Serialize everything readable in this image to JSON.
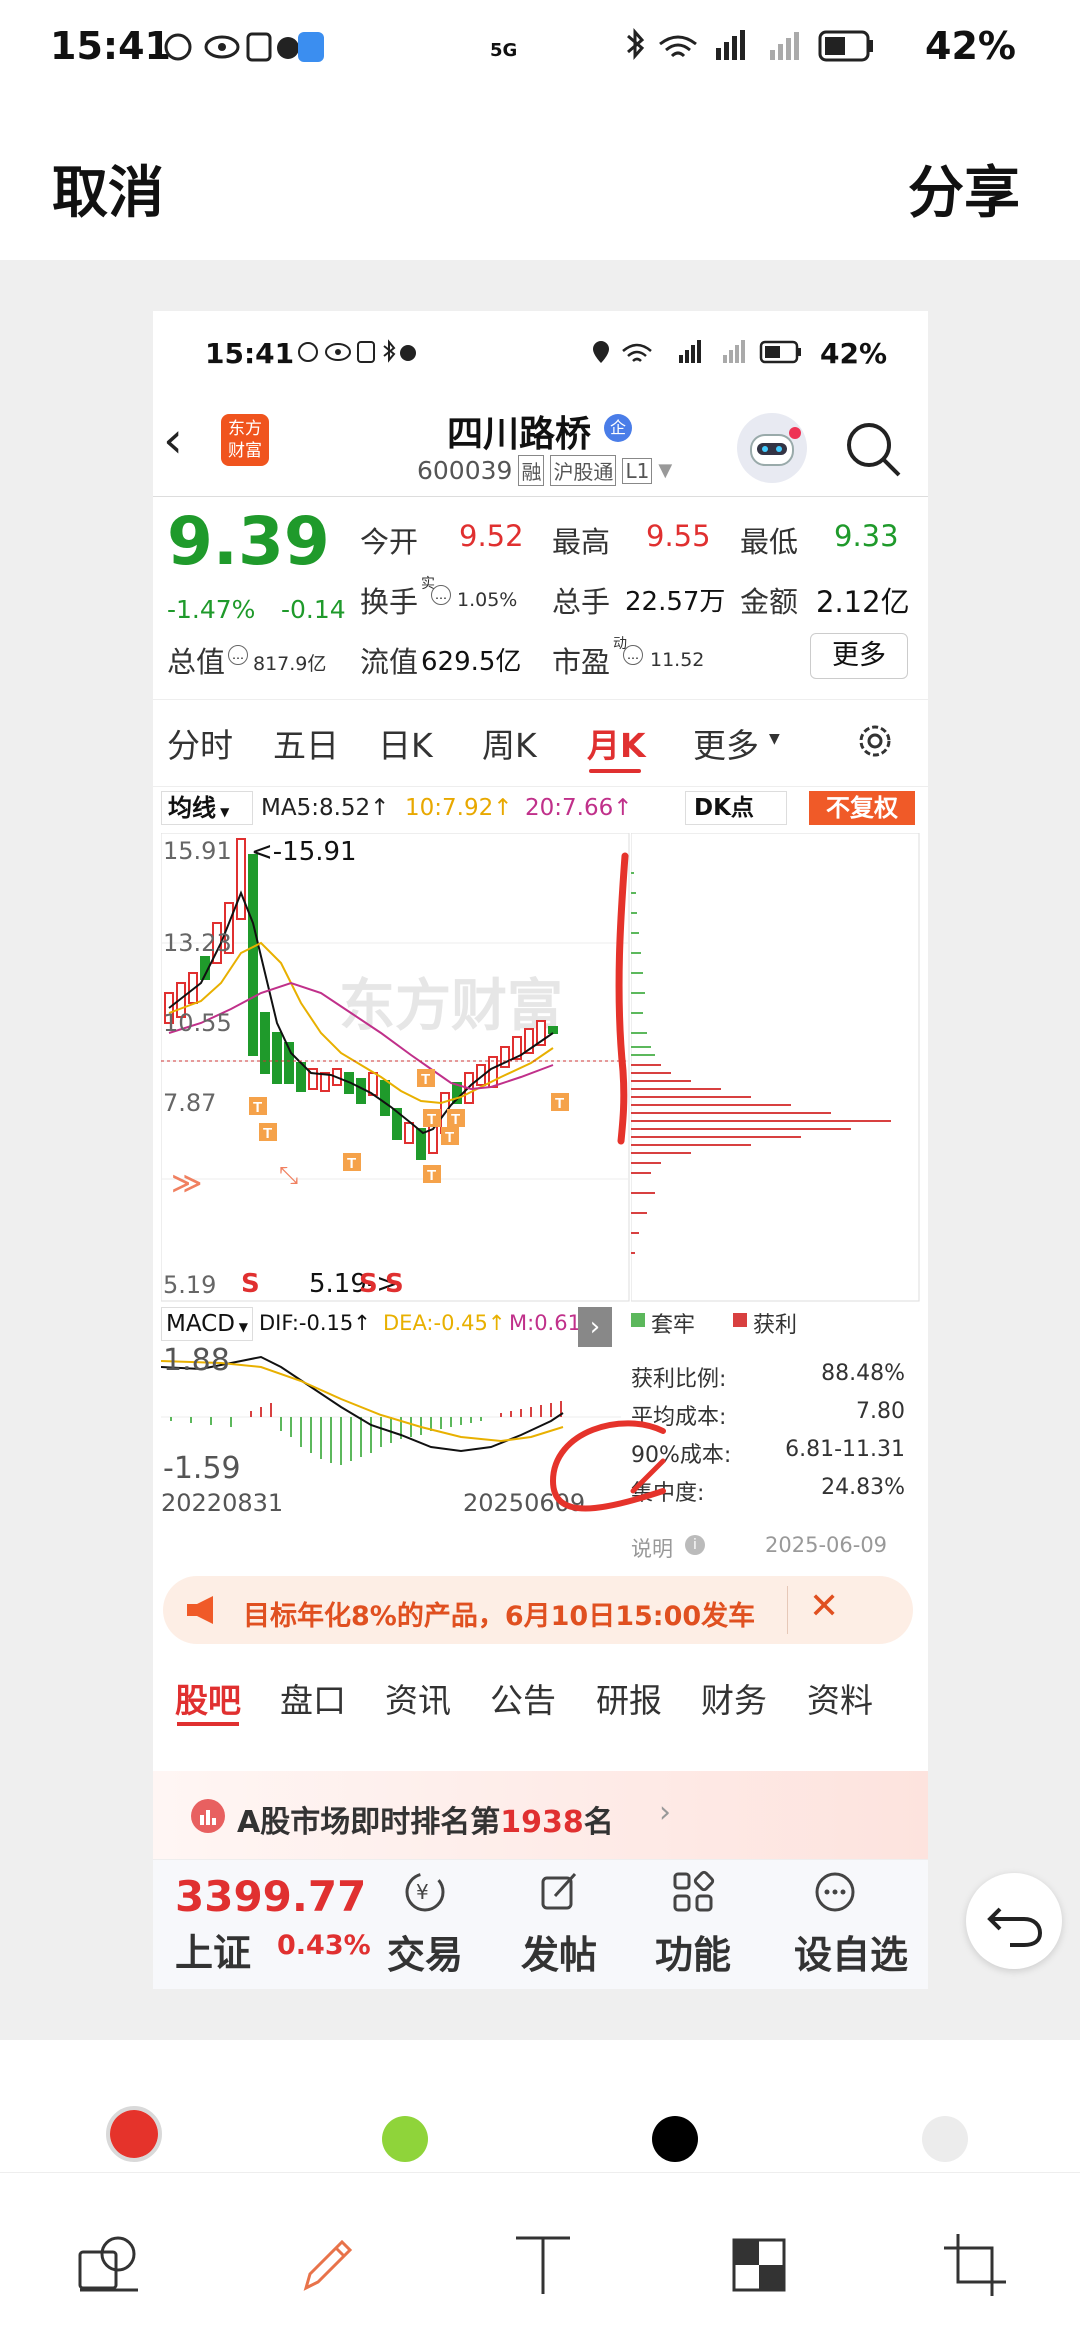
{
  "outer_status": {
    "time": "15:41",
    "network": "5G",
    "battery": "42%"
  },
  "topbar": {
    "cancel": "取消",
    "share": "分享"
  },
  "inner_status": {
    "time": "15:41",
    "network": "5G",
    "battery": "42%"
  },
  "header": {
    "logo_line1": "东方",
    "logo_line2": "财富",
    "stock_name": "四川路桥",
    "stock_badge": "企",
    "code": "600039",
    "tag_rong": "融",
    "tag_hgt": "沪股通",
    "tag_level": "L1"
  },
  "quote": {
    "price": "9.39",
    "change_pct": "-1.47%",
    "change_amt": "-0.14",
    "open_label": "今开",
    "open": "9.52",
    "high_label": "最高",
    "high": "9.55",
    "low_label": "最低",
    "low": "9.33",
    "turnover_label": "换手",
    "turnover_sup": "实",
    "turnover": "1.05%",
    "volume_label": "总手",
    "volume": "22.57万",
    "amount_label": "金额",
    "amount": "2.12亿",
    "mktcap_label": "总值",
    "mktcap": "817.9亿",
    "float_label": "流值",
    "float": "629.5亿",
    "pe_label": "市盈",
    "pe_sup": "动",
    "pe": "11.52",
    "more": "更多"
  },
  "period_tabs": [
    "分时",
    "五日",
    "日K",
    "周K",
    "月K",
    "更多"
  ],
  "ma_bar": {
    "selector": "均线",
    "ma5": "MA5:8.52↑",
    "ma10": "10:7.92↑",
    "ma20": "20:7.66↑",
    "dk": "DK点",
    "fq": "不复权"
  },
  "kline": {
    "y_labels": [
      "15.91",
      "13.23",
      "10.55",
      "7.87",
      "5.19"
    ],
    "high_note": "<-15.91",
    "low_note": "5.19->",
    "markers": [
      "S",
      "S",
      "S"
    ],
    "watermark": "东方财富"
  },
  "macd_bar": {
    "selector": "MACD",
    "dif": "DIF:-0.15↑",
    "dea": "DEA:-0.45↑",
    "m": "M:0.61↑"
  },
  "macd": {
    "y_top": "1.88",
    "y_bottom": "-1.59",
    "x_start": "20220831",
    "x_end": "20250609"
  },
  "chip_legend": {
    "trapped": "套牢",
    "profit": "获利"
  },
  "chip_stats": [
    {
      "label": "获利比例:",
      "value": "88.48%"
    },
    {
      "label": "平均成本:",
      "value": "7.80"
    },
    {
      "label": "90%成本:",
      "value": "6.81-11.31"
    },
    {
      "label": "集中度:",
      "value": "24.83%"
    }
  ],
  "chip_footer": {
    "explain": "说明",
    "date": "2025-06-09"
  },
  "banner": {
    "text": "目标年化8%的产品，6月10日15:00发车"
  },
  "section_tabs": [
    "股吧",
    "盘口",
    "资讯",
    "公告",
    "研报",
    "财务",
    "资料"
  ],
  "rank": {
    "prefix": "A股市场即时排名第",
    "number": "1938",
    "suffix": "名"
  },
  "bottom_nav": {
    "index_value": "3399.77",
    "index_name": "上证",
    "index_pct": "0.43%",
    "items": [
      "交易",
      "发帖",
      "功能",
      "设自选"
    ]
  },
  "palette": {
    "red": "#e5332b",
    "green": "#8fd43a",
    "black": "#000000",
    "light": "#ececec"
  },
  "edit_tools": [
    "crop-layers-icon",
    "pen-icon",
    "text-icon",
    "mosaic-icon",
    "crop-icon"
  ]
}
